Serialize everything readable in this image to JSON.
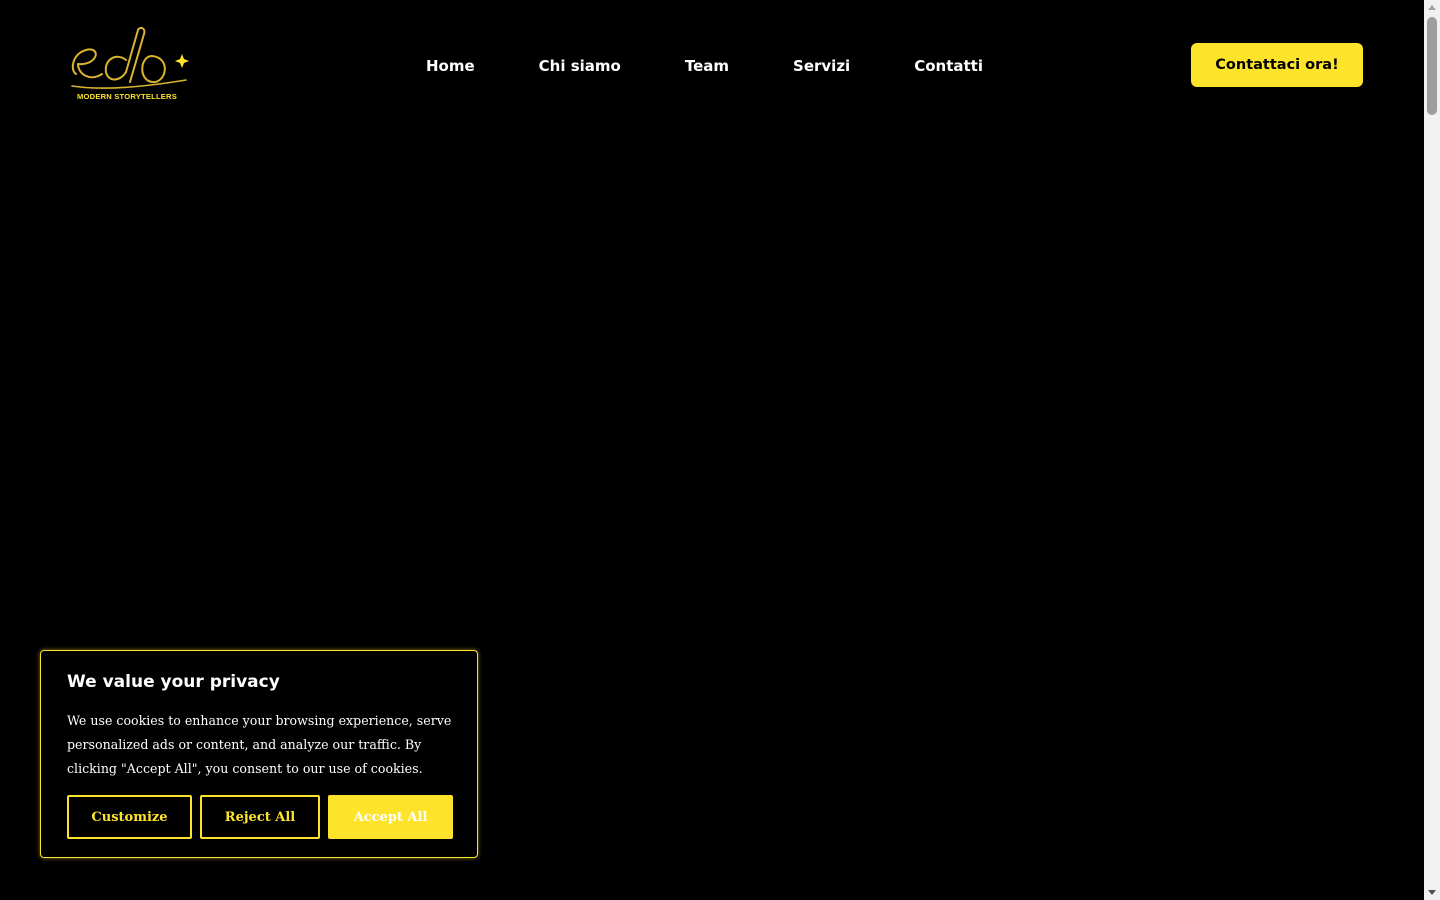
{
  "colors": {
    "accent": "#fde42a",
    "background": "#000000",
    "text": "#ffffff"
  },
  "logo": {
    "icon": "edo-logo",
    "text": "edo",
    "tagline": "MODERN STORYTELLERS"
  },
  "nav": {
    "items": [
      {
        "label": "Home"
      },
      {
        "label": "Chi siamo"
      },
      {
        "label": "Team"
      },
      {
        "label": "Servizi"
      },
      {
        "label": "Contatti"
      }
    ]
  },
  "header": {
    "cta_label": "Contattaci ora!"
  },
  "cookie_banner": {
    "title": "We value your privacy",
    "text": "We use cookies to enhance your browsing experience, serve personalized ads or content, and analyze our traffic. By clicking \"Accept All\", you consent to our use of cookies.",
    "customize_label": "Customize",
    "reject_label": "Reject All",
    "accept_label": "Accept All"
  }
}
